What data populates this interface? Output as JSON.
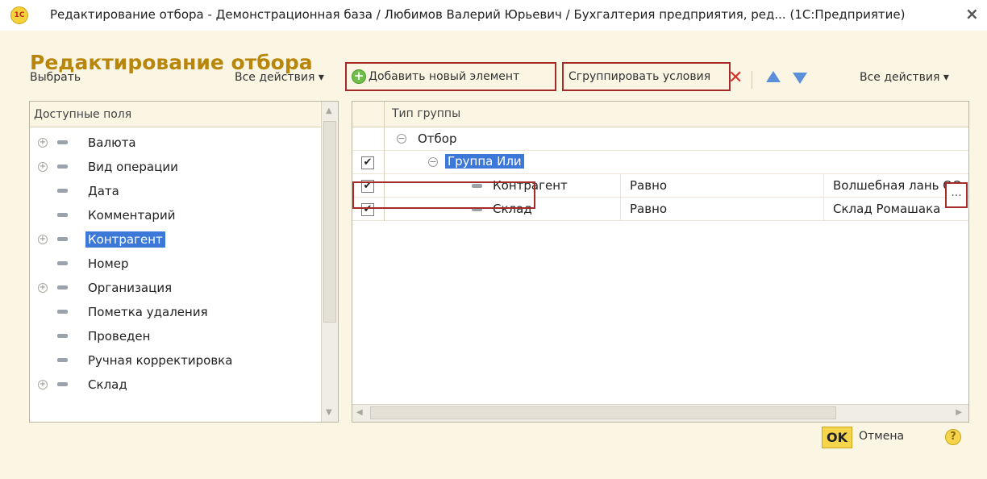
{
  "window": {
    "logo_text": "1С",
    "title": "Редактирование отбора - Демонстрационная база / Любимов Валерий Юрьевич / Бухгалтерия предприятия, ред... (1С:Предприятие)",
    "close_glyph": "×"
  },
  "form": {
    "title": "Редактирование отбора"
  },
  "left_toolbar": {
    "select_label": "Выбрать",
    "all_actions_label": "Все действия ▾"
  },
  "right_toolbar": {
    "add_label": "Добавить новый элемент",
    "group_label": "Сгруппировать условия",
    "all_actions_label": "Все действия ▾"
  },
  "fields_panel": {
    "header": "Доступные поля",
    "items": [
      {
        "label": "Валюта",
        "expandable": true
      },
      {
        "label": "Вид операции",
        "expandable": true
      },
      {
        "label": "Дата",
        "expandable": false
      },
      {
        "label": "Комментарий",
        "expandable": false
      },
      {
        "label": "Контрагент",
        "expandable": true,
        "selected": true
      },
      {
        "label": "Номер",
        "expandable": false
      },
      {
        "label": "Организация",
        "expandable": true
      },
      {
        "label": "Пометка удаления",
        "expandable": false
      },
      {
        "label": "Проведен",
        "expandable": false
      },
      {
        "label": "Ручная корректировка",
        "expandable": false
      },
      {
        "label": "Склад",
        "expandable": true
      }
    ]
  },
  "filter_tree": {
    "header": "Тип группы",
    "root": "Отбор",
    "group": {
      "label": "Группа Или",
      "checked": true
    },
    "conditions": [
      {
        "field": "Контрагент",
        "comparison": "Равно",
        "value": "Волшебная лань ОО",
        "checked": true
      },
      {
        "field": "Склад",
        "comparison": "Равно",
        "value": "Склад Ромашака",
        "checked": true
      }
    ],
    "ellipsis": "..."
  },
  "buttons": {
    "ok": "OK",
    "cancel": "Отмена",
    "help": "?"
  },
  "colors": {
    "title_accent": "#b8860b",
    "selection": "#3b78d8",
    "highlight_frame": "#a52a2a",
    "ok_button": "#f6d54c"
  }
}
